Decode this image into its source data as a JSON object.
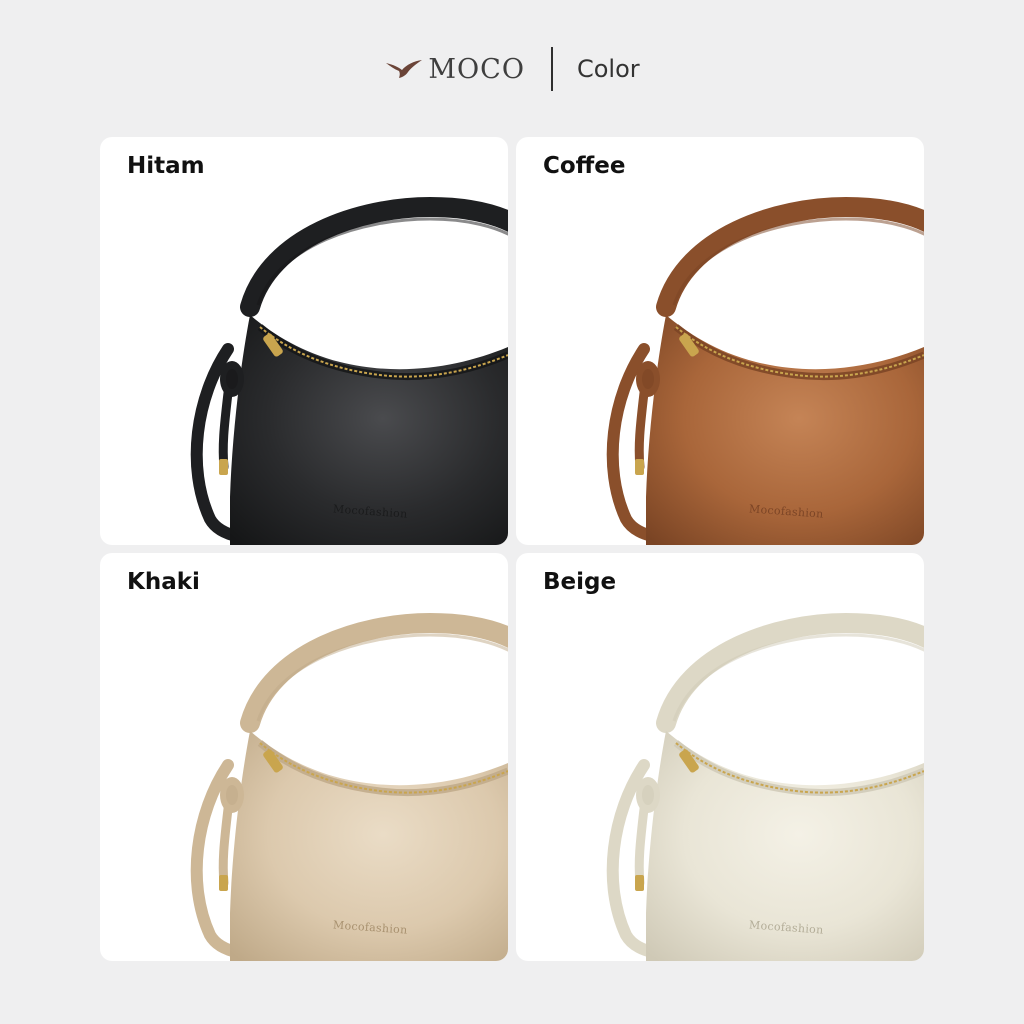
{
  "header": {
    "brand": "MOCO",
    "section": "Color"
  },
  "variants": [
    {
      "name": "Hitam",
      "emboss": "Mocofashion",
      "colors": {
        "body": "#2a2b2d",
        "dark": "#151617",
        "light": "#4a4b4e",
        "strap": "#1e1f21",
        "emboss": "#1a1b1c"
      }
    },
    {
      "name": "Coffee",
      "emboss": "Mocofashion",
      "colors": {
        "body": "#a9663a",
        "dark": "#7a4424",
        "light": "#c58456",
        "strap": "#8a4f2b",
        "emboss": "#7c4526"
      }
    },
    {
      "name": "Khaki",
      "emboss": "Mocofashion",
      "colors": {
        "body": "#dcc9ad",
        "dark": "#bfa988",
        "light": "#eadcc6",
        "strap": "#cdb796",
        "emboss": "#a8916f"
      }
    },
    {
      "name": "Beige",
      "emboss": "Mocofashion",
      "colors": {
        "body": "#e9e5d6",
        "dark": "#cfc9b6",
        "light": "#f4f1e6",
        "strap": "#ddd8c6",
        "emboss": "#b3ad98"
      }
    }
  ]
}
